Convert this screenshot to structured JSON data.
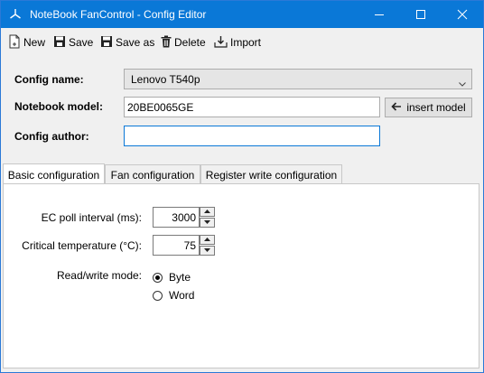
{
  "window": {
    "title": "NoteBook FanControl - Config Editor",
    "accent_color": "#0a78d7",
    "icons": {
      "app": "fan-icon",
      "minimize": "minimize-icon",
      "maximize": "maximize-icon",
      "close": "close-icon"
    }
  },
  "toolbar": {
    "new_label": "New",
    "save_label": "Save",
    "save_as_label": "Save as",
    "delete_label": "Delete",
    "import_label": "Import"
  },
  "form": {
    "config_name_label": "Config name:",
    "config_name_value": "Lenovo T540p",
    "notebook_model_label": "Notebook model:",
    "notebook_model_value": "20BE0065GE",
    "insert_model_label": "insert model",
    "config_author_label": "Config author:",
    "config_author_value": ""
  },
  "tabs": [
    {
      "label": "Basic configuration",
      "active": true
    },
    {
      "label": "Fan configuration",
      "active": false
    },
    {
      "label": "Register write configuration",
      "active": false
    }
  ],
  "basic": {
    "ec_poll_label": "EC poll interval (ms):",
    "ec_poll_value": "3000",
    "critical_temp_label": "Critical temperature (°C):",
    "critical_temp_value": "75",
    "rw_mode_label": "Read/write mode:",
    "rw_options": [
      {
        "label": "Byte",
        "checked": true
      },
      {
        "label": "Word",
        "checked": false
      }
    ]
  }
}
